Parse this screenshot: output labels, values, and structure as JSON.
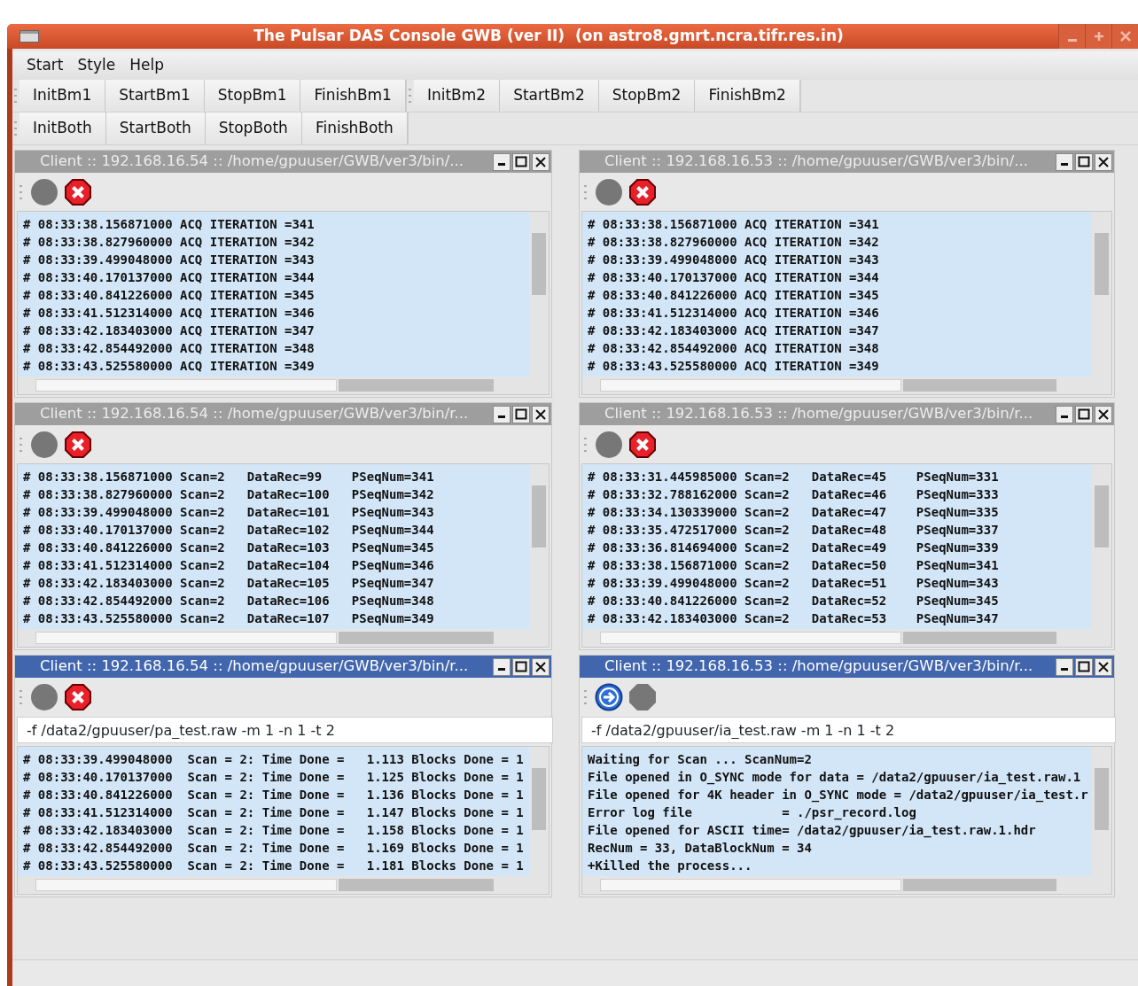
{
  "window": {
    "title": "The Pulsar DAS Console GWB (ver II)  (on astro8.gmrt.ncra.tifr.res.in)"
  },
  "menu": [
    {
      "label": "Start"
    },
    {
      "label": "Style"
    },
    {
      "label": "Help"
    }
  ],
  "toolbars": [
    [
      [
        "InitBm1",
        "StartBm1",
        "StopBm1",
        "FinishBm1"
      ],
      [
        "InitBm2",
        "StartBm2",
        "StopBm2",
        "FinishBm2"
      ]
    ],
    [
      [
        "InitBoth",
        "StartBoth",
        "StopBoth",
        "FinishBoth"
      ]
    ]
  ],
  "panels": [
    {
      "title": "Client :: 192.168.16.54 :: /home/gpuuser/GWB/ver3/bin/...",
      "active": false,
      "tools": [
        {
          "kind": "idle"
        },
        {
          "kind": "kill"
        }
      ],
      "log": [
        "# 08:33:38.156871000 ACQ ITERATION =341",
        "# 08:33:38.827960000 ACQ ITERATION =342",
        "# 08:33:39.499048000 ACQ ITERATION =343",
        "# 08:33:40.170137000 ACQ ITERATION =344",
        "# 08:33:40.841226000 ACQ ITERATION =345",
        "# 08:33:41.512314000 ACQ ITERATION =346",
        "# 08:33:42.183403000 ACQ ITERATION =347",
        "# 08:33:42.854492000 ACQ ITERATION =348",
        "# 08:33:43.525580000 ACQ ITERATION =349"
      ]
    },
    {
      "title": "Client :: 192.168.16.53 :: /home/gpuuser/GWB/ver3/bin/...",
      "active": false,
      "tools": [
        {
          "kind": "idle"
        },
        {
          "kind": "kill"
        }
      ],
      "log": [
        "# 08:33:38.156871000 ACQ ITERATION =341",
        "# 08:33:38.827960000 ACQ ITERATION =342",
        "# 08:33:39.499048000 ACQ ITERATION =343",
        "# 08:33:40.170137000 ACQ ITERATION =344",
        "# 08:33:40.841226000 ACQ ITERATION =345",
        "# 08:33:41.512314000 ACQ ITERATION =346",
        "# 08:33:42.183403000 ACQ ITERATION =347",
        "# 08:33:42.854492000 ACQ ITERATION =348",
        "# 08:33:43.525580000 ACQ ITERATION =349"
      ]
    },
    {
      "title": "Client :: 192.168.16.54 :: /home/gpuuser/GWB/ver3/bin/r...",
      "active": false,
      "tools": [
        {
          "kind": "idle"
        },
        {
          "kind": "kill"
        }
      ],
      "log": [
        "# 08:33:38.156871000 Scan=2   DataRec=99    PSeqNum=341",
        "# 08:33:38.827960000 Scan=2   DataRec=100   PSeqNum=342",
        "# 08:33:39.499048000 Scan=2   DataRec=101   PSeqNum=343",
        "# 08:33:40.170137000 Scan=2   DataRec=102   PSeqNum=344",
        "# 08:33:40.841226000 Scan=2   DataRec=103   PSeqNum=345",
        "# 08:33:41.512314000 Scan=2   DataRec=104   PSeqNum=346",
        "# 08:33:42.183403000 Scan=2   DataRec=105   PSeqNum=347",
        "# 08:33:42.854492000 Scan=2   DataRec=106   PSeqNum=348",
        "# 08:33:43.525580000 Scan=2   DataRec=107   PSeqNum=349"
      ]
    },
    {
      "title": "Client :: 192.168.16.53 :: /home/gpuuser/GWB/ver3/bin/r...",
      "active": false,
      "tools": [
        {
          "kind": "idle"
        },
        {
          "kind": "kill"
        }
      ],
      "log": [
        "# 08:33:31.445985000 Scan=2   DataRec=45    PSeqNum=331",
        "# 08:33:32.788162000 Scan=2   DataRec=46    PSeqNum=333",
        "# 08:33:34.130339000 Scan=2   DataRec=47    PSeqNum=335",
        "# 08:33:35.472517000 Scan=2   DataRec=48    PSeqNum=337",
        "# 08:33:36.814694000 Scan=2   DataRec=49    PSeqNum=339",
        "# 08:33:38.156871000 Scan=2   DataRec=50    PSeqNum=341",
        "# 08:33:39.499048000 Scan=2   DataRec=51    PSeqNum=343",
        "# 08:33:40.841226000 Scan=2   DataRec=52    PSeqNum=345",
        "# 08:33:42.183403000 Scan=2   DataRec=53    PSeqNum=347"
      ]
    },
    {
      "title": "Client :: 192.168.16.54 :: /home/gpuuser/GWB/ver3/bin/r...",
      "active": true,
      "tools": [
        {
          "kind": "idle"
        },
        {
          "kind": "kill"
        }
      ],
      "command": "-f /data2/gpuuser/pa_test.raw -m 1 -n 1 -t 2",
      "log": [
        "# 08:33:39.499048000  Scan = 2: Time Done =   1.113 Blocks Done = 1",
        "# 08:33:40.170137000  Scan = 2: Time Done =   1.125 Blocks Done = 1",
        "# 08:33:40.841226000  Scan = 2: Time Done =   1.136 Blocks Done = 1",
        "# 08:33:41.512314000  Scan = 2: Time Done =   1.147 Blocks Done = 1",
        "# 08:33:42.183403000  Scan = 2: Time Done =   1.158 Blocks Done = 1",
        "# 08:33:42.854492000  Scan = 2: Time Done =   1.169 Blocks Done = 1",
        "# 08:33:43.525580000  Scan = 2: Time Done =   1.181 Blocks Done = 1"
      ]
    },
    {
      "title": "Client :: 192.168.16.53 :: /home/gpuuser/GWB/ver3/bin/r...",
      "active": true,
      "tools": [
        {
          "kind": "run"
        },
        {
          "kind": "halted"
        }
      ],
      "command": "-f /data2/gpuuser/ia_test.raw -m 1 -n 1 -t 2",
      "log": [
        "Waiting for Scan ... ScanNum=2",
        "File opened in O_SYNC mode for data = /data2/gpuuser/ia_test.raw.1",
        "File opened for 4K header in O_SYNC mode = /data2/gpuuser/ia_test.r",
        "Error log file            = ./psr_record.log",
        "File opened for ASCII time= /data2/gpuuser/ia_test.raw.1.hdr",
        "RecNum = 33, DataBlockNum = 34",
        "+Killed the process..."
      ]
    }
  ]
}
